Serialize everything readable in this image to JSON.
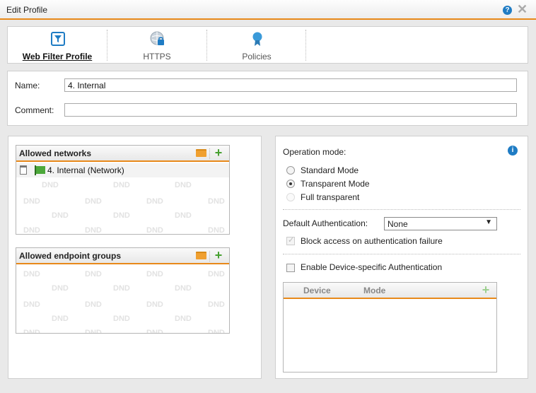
{
  "window": {
    "title": "Edit Profile"
  },
  "tabs": [
    {
      "label": "Web Filter Profile",
      "icon": "filter-icon",
      "active": true
    },
    {
      "label": "HTTPS",
      "icon": "globe-lock-icon",
      "active": false
    },
    {
      "label": "Policies",
      "icon": "ribbon-icon",
      "active": false
    }
  ],
  "form": {
    "name_label": "Name:",
    "name_value": "4. Internal",
    "comment_label": "Comment:",
    "comment_value": ""
  },
  "allowed_networks": {
    "title": "Allowed networks",
    "items": [
      {
        "label": "4. Internal (Network)"
      }
    ],
    "dnd_text": "DND"
  },
  "allowed_endpoint_groups": {
    "title": "Allowed endpoint groups",
    "dnd_text": "DND"
  },
  "operation": {
    "label": "Operation mode:",
    "options": [
      {
        "label": "Standard Mode",
        "checked": false,
        "disabled": false
      },
      {
        "label": "Transparent Mode",
        "checked": true,
        "disabled": false
      },
      {
        "label": "Full transparent",
        "checked": false,
        "disabled": true
      }
    ]
  },
  "auth": {
    "default_label": "Default Authentication:",
    "default_value": "None",
    "block_label": "Block access on authentication failure",
    "block_checked": true,
    "device_specific_label": "Enable Device-specific Authentication",
    "device_specific_checked": false
  },
  "device_table": {
    "columns": [
      "Device",
      "Mode"
    ]
  },
  "colors": {
    "accent": "#e8891a",
    "info": "#1f7cc4",
    "add": "#46a030"
  }
}
